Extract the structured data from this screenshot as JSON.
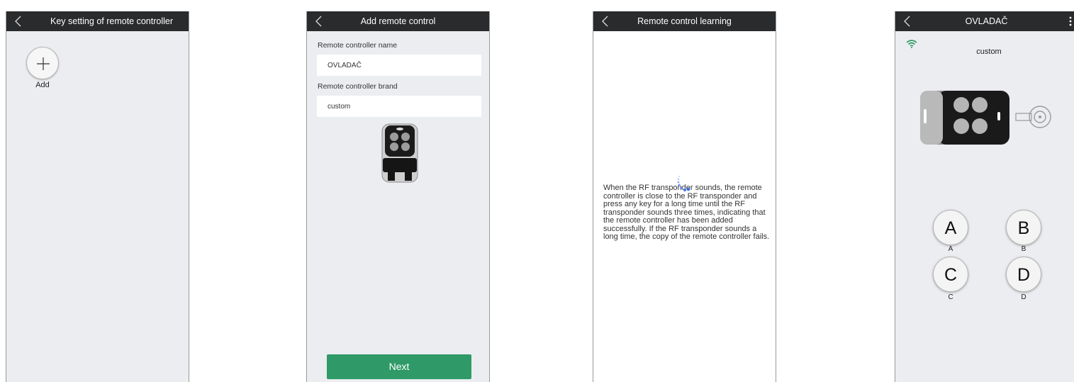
{
  "screen1": {
    "title": "Key setting of remote controller",
    "add_label": "Add"
  },
  "screen2": {
    "title": "Add remote control",
    "name_label": "Remote controller name",
    "name_value": "OVLADAČ",
    "brand_label": "Remote controller brand",
    "brand_value": "custom",
    "next_label": "Next"
  },
  "screen3": {
    "title": "Remote control learning",
    "instructions": "When the RF transponder sounds, the remote controller is close to the RF transponder and press any key for a long time until the RF transponder sounds three times, indicating that the remote controller has been added successfully. If the RF transponder sounds a long time, the copy of the remote controller fails."
  },
  "screen4": {
    "title": "OVLADAČ",
    "brand": "custom",
    "keys": [
      {
        "symbol": "A",
        "label": "A"
      },
      {
        "symbol": "B",
        "label": "B"
      },
      {
        "symbol": "C",
        "label": "C"
      },
      {
        "symbol": "D",
        "label": "D"
      }
    ]
  },
  "colors": {
    "titlebar": "#2a2b2d",
    "background": "#ecedf1",
    "accent": "#2f9a67",
    "wifi": "#2f9a67",
    "spinner": "#3a6fe0"
  },
  "icons": [
    "back-chevron-icon",
    "plus-icon",
    "remote-fob-icon",
    "wifi-icon",
    "more-vertical-icon",
    "key-fob-icon",
    "loading-spinner-icon"
  ]
}
